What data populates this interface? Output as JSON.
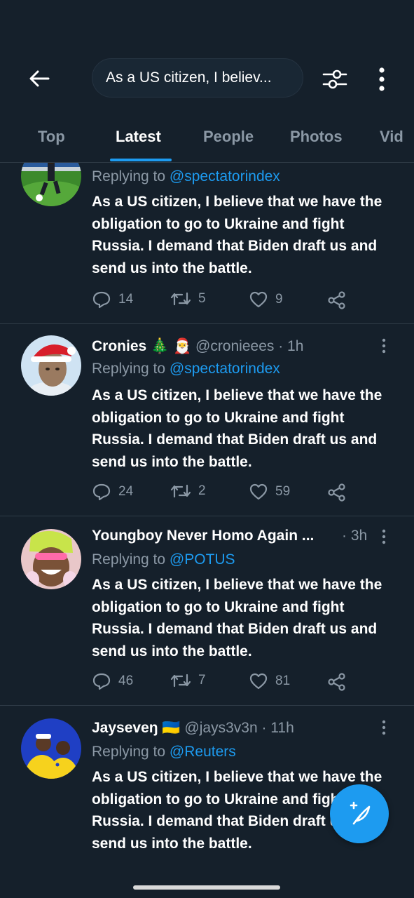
{
  "search": {
    "query": "As a US citizen, I believ..."
  },
  "tabs": [
    {
      "label": "Top"
    },
    {
      "label": "Latest"
    },
    {
      "label": "People"
    },
    {
      "label": "Photos"
    },
    {
      "label": "Vid"
    }
  ],
  "tweets": [
    {
      "name": "",
      "handle": "",
      "time": "",
      "replying_prefix": "Replying to ",
      "replying_to": "@spectatorindex",
      "text": "As a US citizen, I believe that we have the obligation to go to Ukraine and fight Russia. I demand that Biden draft us and send us into the battle.",
      "replies": "14",
      "retweets": "5",
      "likes": "9"
    },
    {
      "name": "Cronies 🎄 🎅",
      "handle": "@cronieees",
      "time": "· 1h",
      "replying_prefix": "Replying to ",
      "replying_to": "@spectatorindex",
      "text": "As a US citizen, I believe that we have the obligation to go to Ukraine and fight Russia. I demand that Biden draft us and send us into the battle.",
      "replies": "24",
      "retweets": "2",
      "likes": "59"
    },
    {
      "name": "Youngboy Never Homo Again ...",
      "handle": "",
      "time": "· 3h",
      "replying_prefix": "Replying to ",
      "replying_to": "@POTUS",
      "text": "As a US citizen, I believe that we have the obligation to go to Ukraine and fight Russia. I demand that Biden draft us and send us into the battle.",
      "replies": "46",
      "retweets": "7",
      "likes": "81"
    },
    {
      "name": "Jayseveŋ 🇺🇦",
      "handle": "@jays3v3n",
      "time": "· 11h",
      "replying_prefix": "Replying to ",
      "replying_to": "@Reuters",
      "text": "As a US citizen, I believe that we have the obligation to go to Ukraine and fight Russia. I demand that Biden draft us and send us into the battle.",
      "replies": "",
      "retweets": "",
      "likes": ""
    }
  ],
  "colors": {
    "background": "#15202b",
    "accent": "#1d9bf0",
    "muted": "#8b98a5"
  },
  "icons": [
    "back-arrow-icon",
    "filter-icon",
    "more-vertical-icon",
    "reply-icon",
    "retweet-icon",
    "like-icon",
    "share-icon",
    "compose-icon"
  ]
}
